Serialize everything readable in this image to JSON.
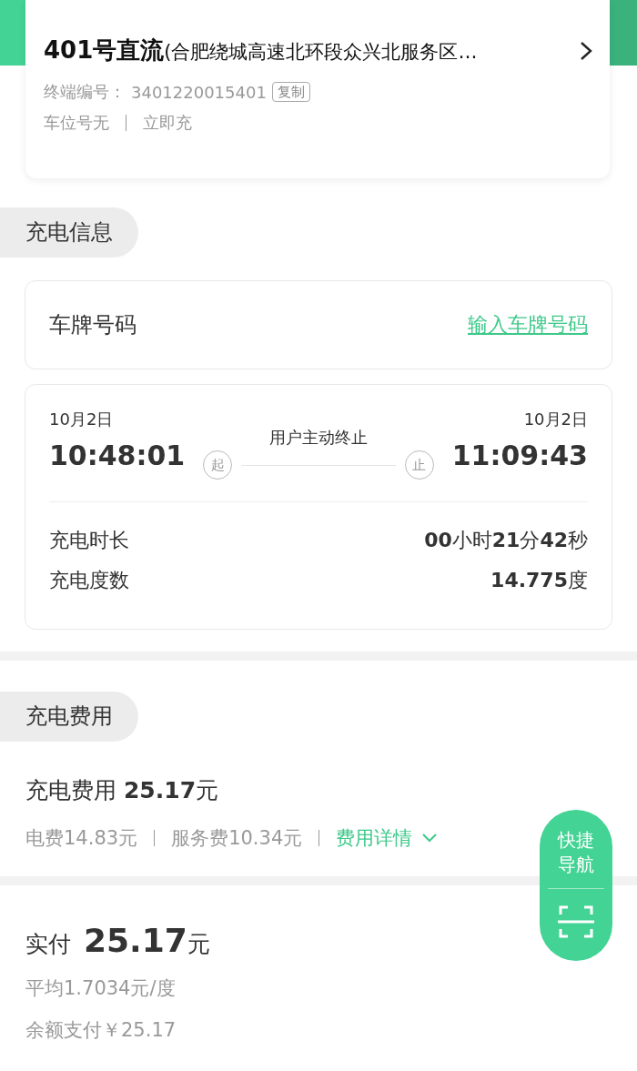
{
  "station": {
    "title": "**401号直流**(合肥绕城高速北环段众兴北服务区…",
    "terminal_label": "终端编号：",
    "terminal_no": "3401220015401",
    "copy_button": "复制",
    "meta": [
      "车位号无",
      "立即充"
    ]
  },
  "charging_info": {
    "section_title": "充电信息",
    "plate_label": "车牌号码",
    "plate_link": "输入车牌号码",
    "start": {
      "date": "10月2日",
      "time": "10:48:01",
      "mark": "起"
    },
    "end": {
      "date": "10月2日",
      "time": "11:09:43",
      "mark": "止"
    },
    "stop_reason": "用户主动终止",
    "stats": [
      {
        "label": "充电时长",
        "value": "**00**小时**21**分**42**秒"
      },
      {
        "label": "充电度数",
        "value": "**14.775**度"
      }
    ]
  },
  "charging_fee": {
    "section_title": "充电费用",
    "total": "充电费用 **25.17**元",
    "parts": [
      "电费14.83元",
      "服务费10.34元"
    ],
    "details_link": "费用详情"
  },
  "payment": {
    "label": "实付",
    "amount": "25.17",
    "unit": "元",
    "average": "平均1.7034元/度",
    "method": "余额支付￥25.17"
  },
  "quick_nav": {
    "label": "快捷导航"
  }
}
